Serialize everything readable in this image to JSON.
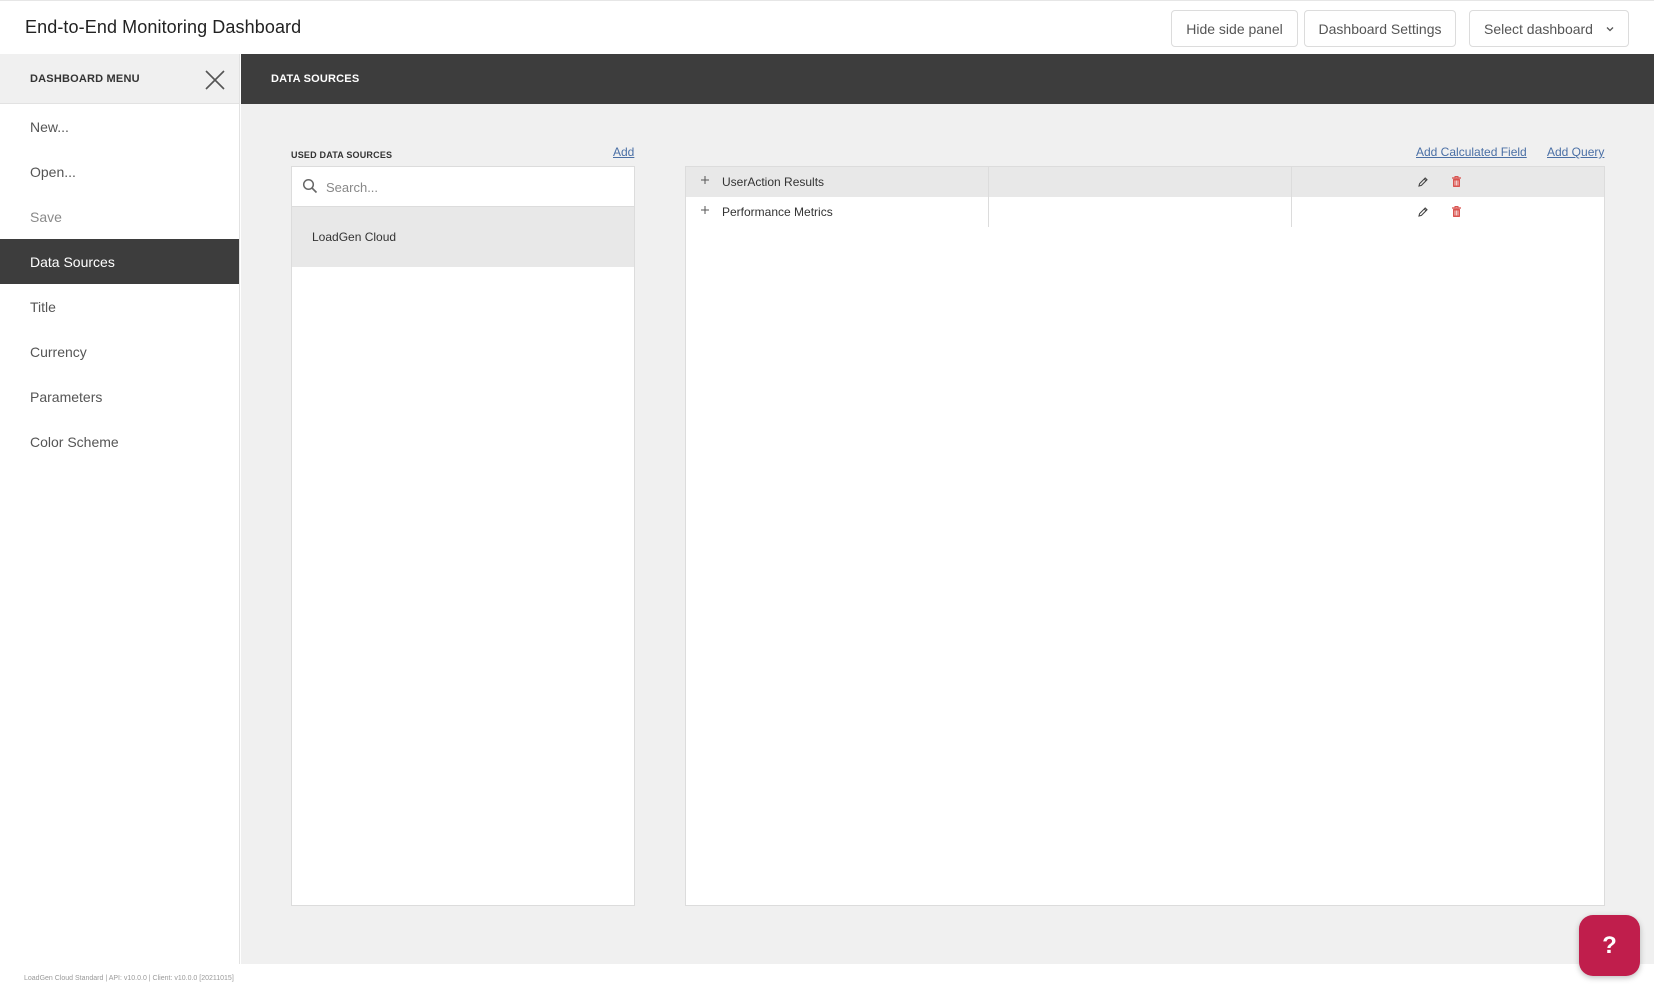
{
  "app": {
    "title": "End-to-End Monitoring Dashboard"
  },
  "toolbar": {
    "hide_panel_label": "Hide side panel",
    "settings_label": "Dashboard Settings",
    "select_dashboard_label": "Select dashboard"
  },
  "sidebar": {
    "header": "DASHBOARD MENU",
    "items": [
      {
        "label": "New..."
      },
      {
        "label": "Open..."
      },
      {
        "label": "Save"
      },
      {
        "label": "Data Sources"
      },
      {
        "label": "Title"
      },
      {
        "label": "Currency"
      },
      {
        "label": "Parameters"
      },
      {
        "label": "Color Scheme"
      }
    ],
    "active_item": "Data Sources"
  },
  "content": {
    "header": "DATA SOURCES",
    "used_label": "USED DATA SOURCES",
    "add_label": "Add",
    "add_calculated_field_label": "Add Calculated Field",
    "add_query_label": "Add Query",
    "search": {
      "placeholder": "Search...",
      "value": ""
    },
    "data_sources": [
      {
        "name": "LoadGen Cloud"
      }
    ],
    "queries": [
      {
        "name": "UserAction Results"
      },
      {
        "name": "Performance Metrics"
      }
    ]
  },
  "footer": {
    "version": "LoadGen Cloud Standard | API: v10.0.0 | Client: v10.0.0 [20211015]"
  },
  "help": {
    "label": "?"
  },
  "colors": {
    "accent_dark": "#3d3d3d",
    "help_button": "#c01e4c",
    "link": "#4a6fa5",
    "delete_icon": "#d9534f"
  }
}
